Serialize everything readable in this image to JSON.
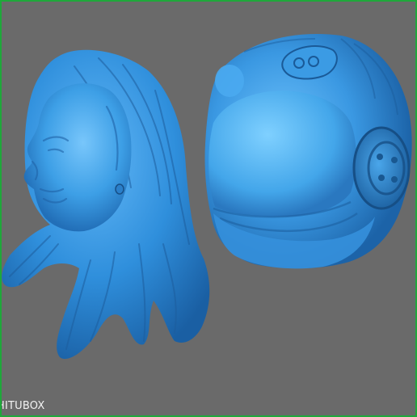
{
  "viewport": {
    "background_color": "#6a6a6a",
    "frame_color": "#1fa83a",
    "model_color": "#3a9de6"
  },
  "models": [
    {
      "name": "woman-head-with-long-hair"
    },
    {
      "name": "motorcycle-helmet"
    }
  ],
  "watermark": {
    "text": "HITUBOX"
  }
}
